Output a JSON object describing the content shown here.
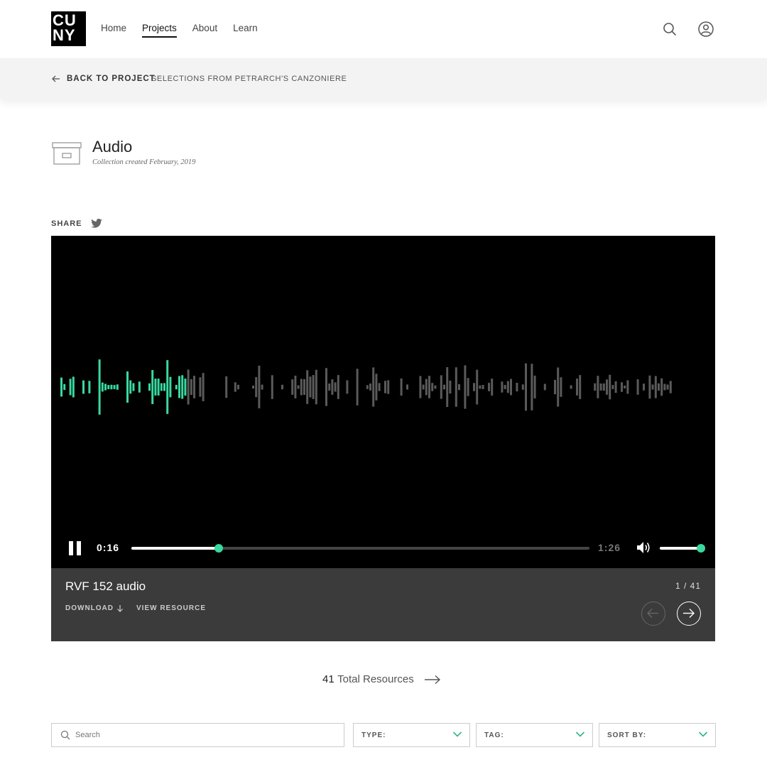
{
  "header": {
    "logo_lines": [
      "CU",
      "NY"
    ],
    "nav": [
      {
        "label": "Home",
        "active": false
      },
      {
        "label": "Projects",
        "active": true
      },
      {
        "label": "About",
        "active": false
      },
      {
        "label": "Learn",
        "active": false
      }
    ],
    "search_icon": "search-icon",
    "account_icon": "user-account-icon"
  },
  "breadcrumb": {
    "back_label": "BACK TO PROJECT",
    "project_name": "SELECTIONS FROM PETRARCH'S CANZONIERE"
  },
  "collection": {
    "title": "Audio",
    "subtitle": "Collection created February, 2019",
    "icon": "archive-box-icon"
  },
  "share": {
    "label": "SHARE",
    "icon": "twitter-icon"
  },
  "player": {
    "current_time": "0:16",
    "duration": "1:26",
    "progress_fraction": 0.19,
    "volume_fraction": 1.0,
    "played_color": "#39d9a0",
    "unplayed_color": "#5a5a5a"
  },
  "resource": {
    "title": "RVF 152 audio",
    "counter": "1 / 41",
    "download_label": "DOWNLOAD",
    "view_label": "VIEW RESOURCE"
  },
  "total": {
    "count": "41",
    "label": "Total Resources"
  },
  "filters": {
    "search_placeholder": "Search",
    "type_label": "TYPE:",
    "tag_label": "TAG:",
    "sort_label": "SORT BY:"
  },
  "colors": {
    "accent": "#39d9a0",
    "info_bar": "#3b3b3b"
  }
}
